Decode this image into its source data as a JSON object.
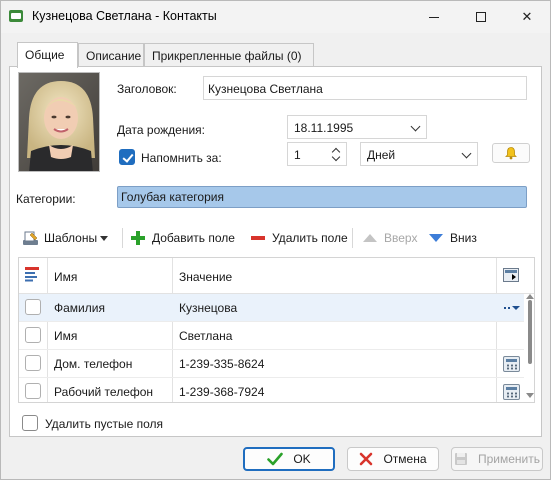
{
  "window": {
    "title": "Кузнецова Светлана - Контакты",
    "minimize_glyph": "",
    "close_glyph": "✕"
  },
  "tabs": [
    {
      "label": "Общие",
      "active": true
    },
    {
      "label": "Описание",
      "active": false
    },
    {
      "label": "Прикрепленные файлы (0)",
      "active": false
    }
  ],
  "general": {
    "title_label": "Заголовок:",
    "title_value": "Кузнецова Светлана",
    "birthdate_label": "Дата рождения:",
    "birthdate_value": "18.11.1995",
    "remind_label": "Напомнить за:",
    "remind_checked": true,
    "remind_amount": "1",
    "remind_unit": "Дней",
    "categories_label": "Категории:",
    "categories_value": "Голубая категория",
    "category_color": "#a6c8ea"
  },
  "toolbar": {
    "templates": "Шаблоны",
    "add_field": "Добавить поле",
    "delete_field": "Удалить поле",
    "up": "Вверх",
    "down": "Вниз"
  },
  "grid": {
    "columns": {
      "name": "Имя",
      "value": "Значение"
    },
    "rows": [
      {
        "name": "Фамилия",
        "value": "Кузнецова",
        "action_icon": "dropdown-icon",
        "selected": true
      },
      {
        "name": "Имя",
        "value": "Светлана",
        "action_icon": "",
        "selected": false
      },
      {
        "name": "Дом. телефон",
        "value": "1-239-335-8624",
        "action_icon": "phone-dialer-icon",
        "selected": false
      },
      {
        "name": "Рабочий телефон",
        "value": "1-239-368-7924",
        "action_icon": "phone-dialer-icon",
        "selected": false
      }
    ]
  },
  "remove_empty_label": "Удалить пустые поля",
  "buttons": {
    "ok": "OK",
    "cancel": "Отмена",
    "apply": "Применить"
  },
  "colors": {
    "accent": "#1f6dbf",
    "add_green": "#2aa12a",
    "delete_red": "#d8342c",
    "selected_row": "#eaf2fb"
  }
}
